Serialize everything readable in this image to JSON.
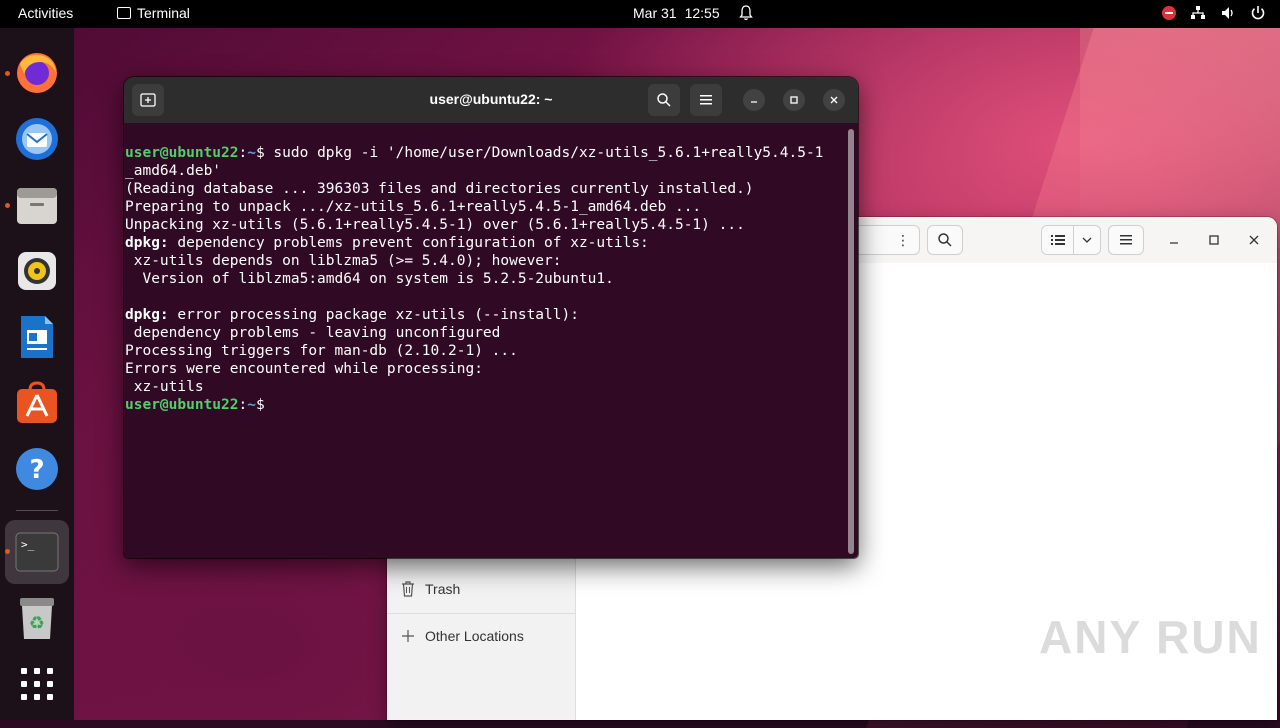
{
  "topbar": {
    "activities": "Activities",
    "app_name": "Terminal",
    "date": "Mar 31",
    "time": "12:55"
  },
  "dock": {
    "apps": [
      {
        "name": "firefox"
      },
      {
        "name": "thunderbird"
      },
      {
        "name": "files"
      },
      {
        "name": "rhythmbox"
      },
      {
        "name": "libreoffice-writer"
      },
      {
        "name": "ubuntu-software"
      },
      {
        "name": "help"
      },
      {
        "name": "terminal"
      },
      {
        "name": "trash"
      },
      {
        "name": "show-applications"
      }
    ]
  },
  "file_manager": {
    "sidebar": {
      "trash": "Trash",
      "other_locations": "Other Locations"
    }
  },
  "terminal": {
    "title": "user@ubuntu22: ~",
    "prompt_user": "user@ubuntu22",
    "prompt_sep": ":",
    "prompt_path": "~",
    "prompt_symbol": "$",
    "command": " sudo dpkg -i '/home/user/Downloads/xz-utils_5.6.1+really5.4.5-1",
    "command_cont": "_amd64.deb'",
    "out1": "(Reading database ... 396303 files and directories currently installed.)",
    "out2": "Preparing to unpack .../xz-utils_5.6.1+really5.4.5-1_amd64.deb ...",
    "out3": "Unpacking xz-utils (5.6.1+really5.4.5-1) over (5.6.1+really5.4.5-1) ...",
    "out4_label": "dpkg:",
    "out4_text": " dependency problems prevent configuration of xz-utils:",
    "out5": " xz-utils depends on liblzma5 (>= 5.4.0); however:",
    "out6": "  Version of liblzma5:amd64 on system is 5.2.5-2ubuntu1.",
    "out7_label": "dpkg:",
    "out7_text": " error processing package xz-utils (--install):",
    "out8": " dependency problems - leaving unconfigured",
    "out9": "Processing triggers for man-db (2.10.2-1) ...",
    "out10": "Errors were encountered while processing:",
    "out11": " xz-utils"
  },
  "watermark": "ANY RUN",
  "colors": {
    "terminal_bg": "#300a24",
    "prompt_user": "#4fd06a",
    "prompt_path": "#6a9bd8",
    "accent": "#e95420"
  }
}
